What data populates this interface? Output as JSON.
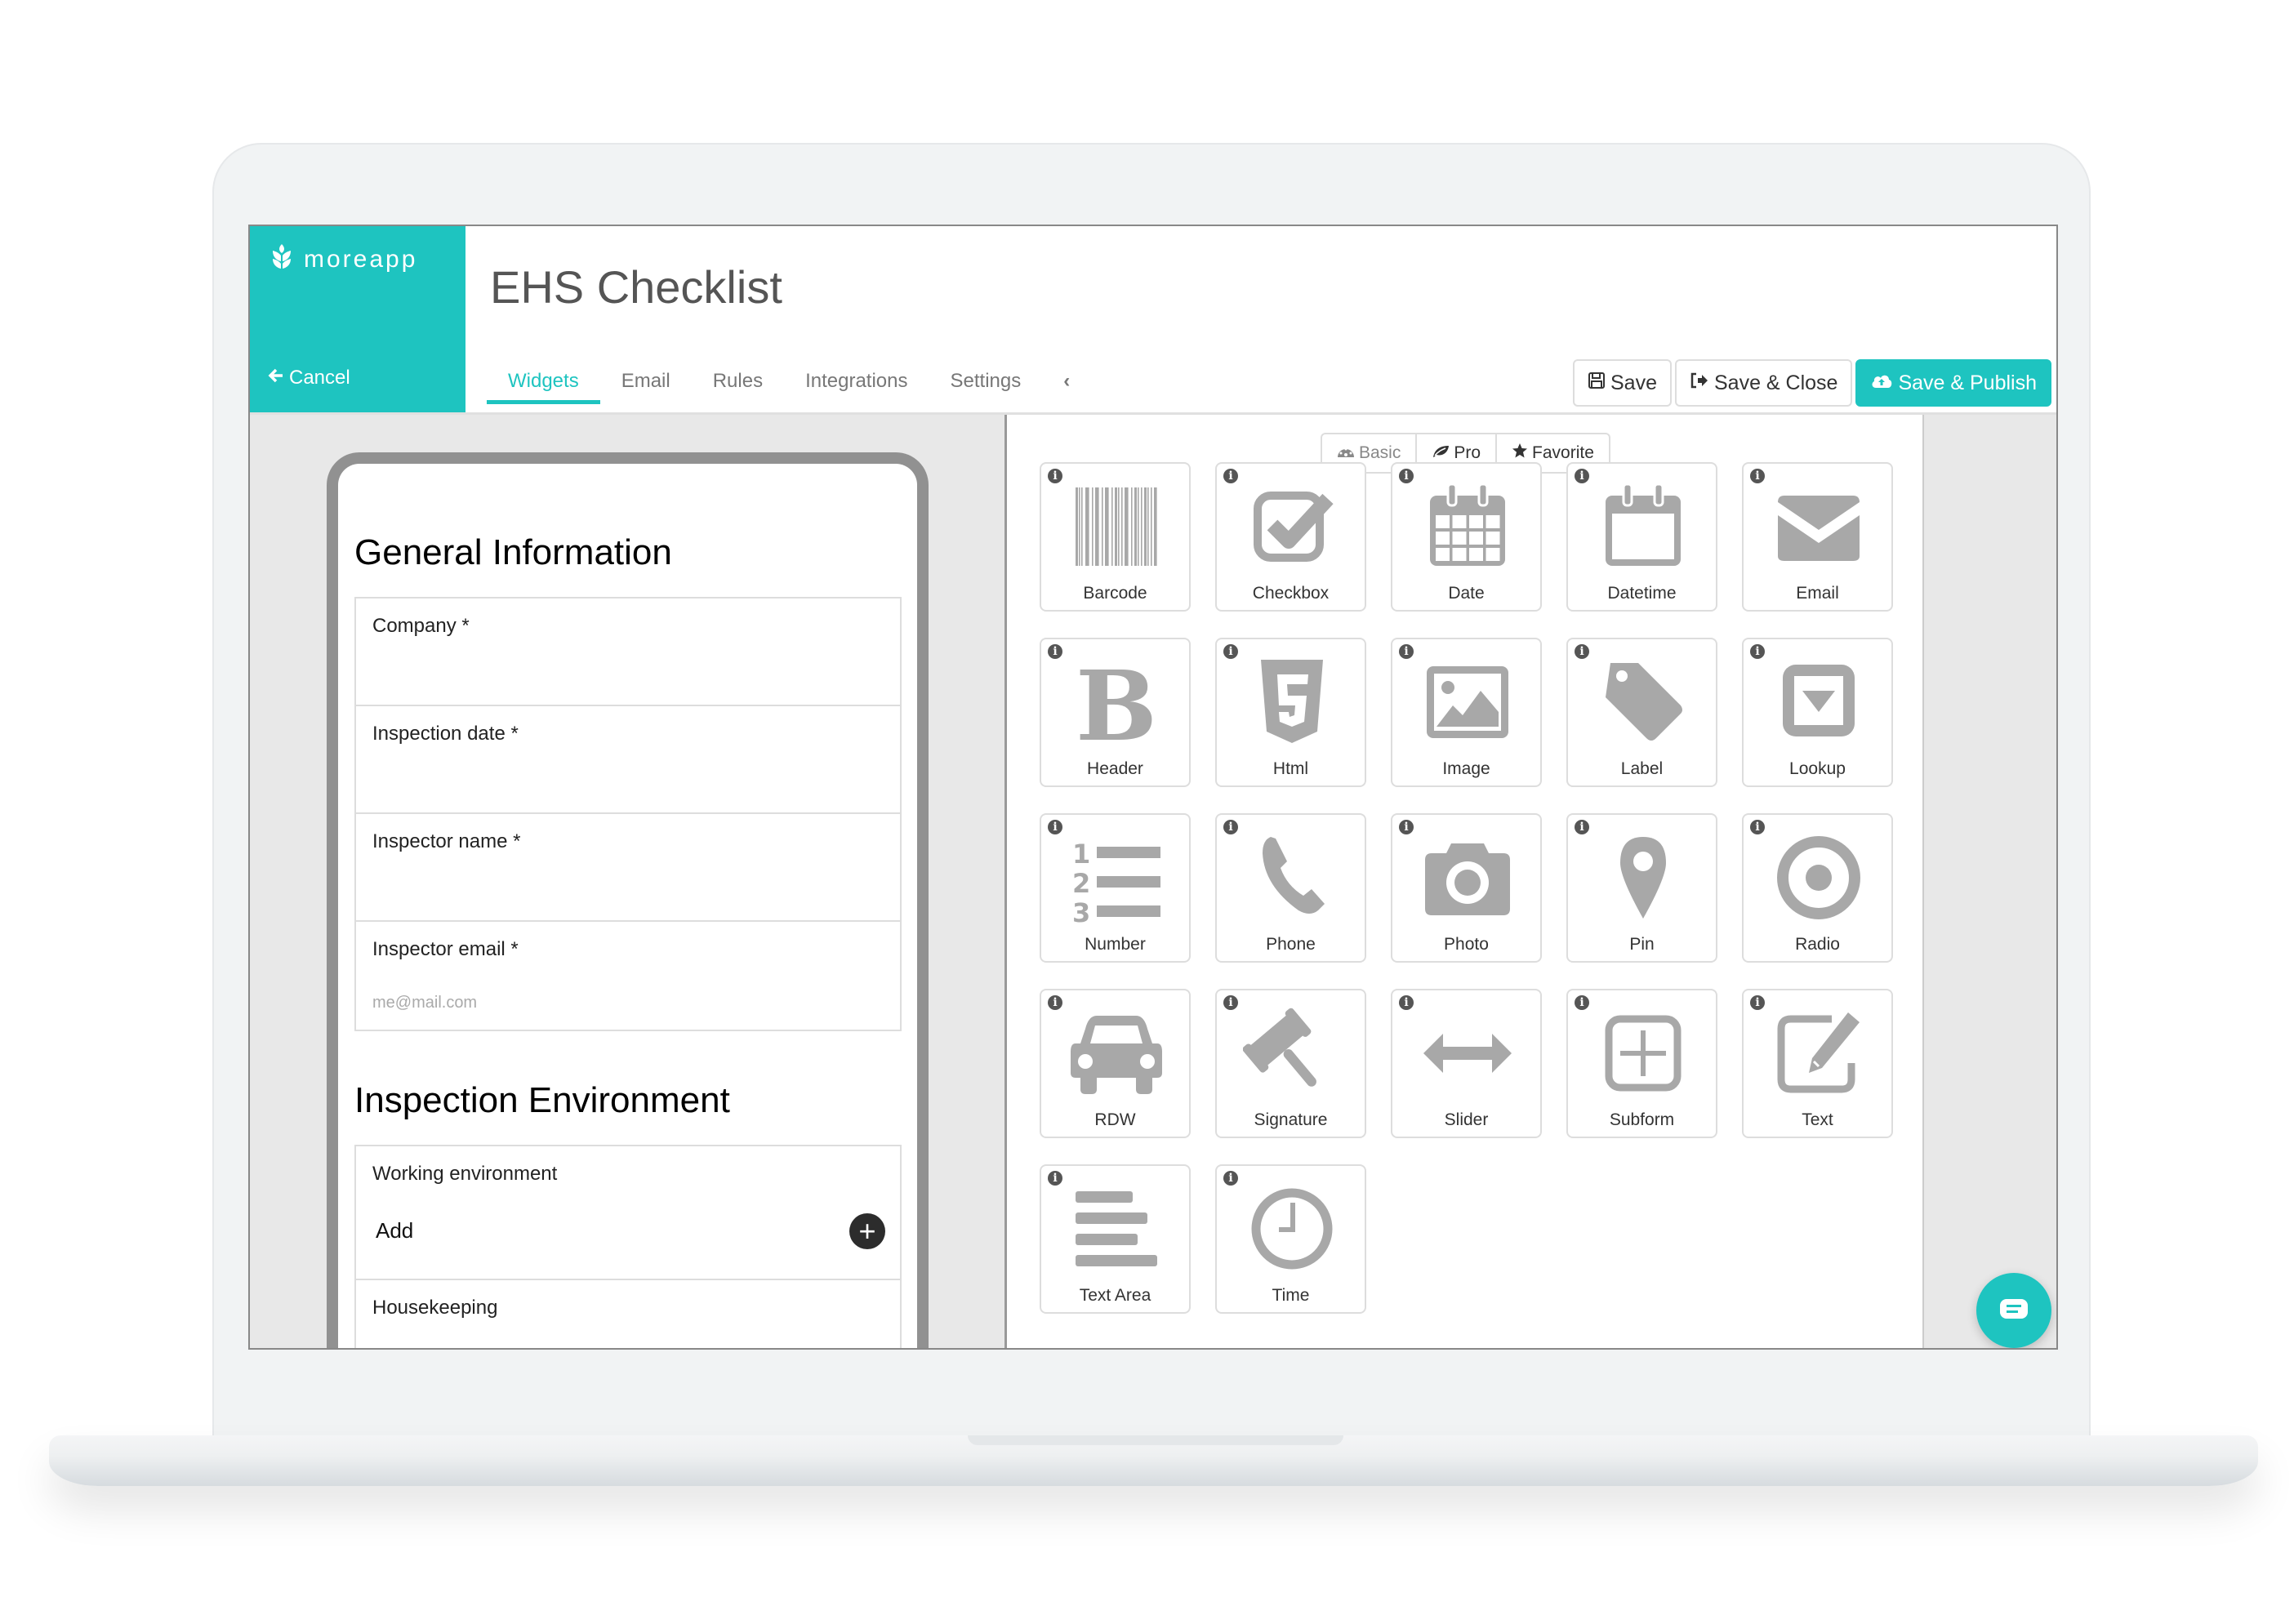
{
  "app": {
    "brand": "moreapp",
    "cancel_label": "Cancel",
    "title": "EHS Checklist",
    "accent_color": "#1ec4c0"
  },
  "tabs": [
    {
      "label": "Widgets",
      "active": true
    },
    {
      "label": "Email",
      "active": false
    },
    {
      "label": "Rules",
      "active": false
    },
    {
      "label": "Integrations",
      "active": false
    },
    {
      "label": "Settings",
      "active": false
    },
    {
      "label": "‹",
      "icon": "chevron-left-icon"
    }
  ],
  "toolbar": {
    "save_label": "Save",
    "save_close_label": "Save & Close",
    "save_publish_label": "Save & Publish"
  },
  "filters": [
    {
      "label": "Basic",
      "icon": "dashboard-icon"
    },
    {
      "label": "Pro",
      "icon": "leaf-icon"
    },
    {
      "label": "Favorite",
      "icon": "star-icon"
    }
  ],
  "form": {
    "sections": [
      {
        "title": "General Information",
        "fields": [
          {
            "label": "Company *",
            "placeholder": ""
          },
          {
            "label": "Inspection date *",
            "placeholder": ""
          },
          {
            "label": "Inspector name *",
            "placeholder": ""
          },
          {
            "label": "Inspector email *",
            "placeholder": "me@mail.com"
          }
        ]
      },
      {
        "title": "Inspection Environment",
        "fields": [
          {
            "label": "Working environment",
            "add_label": "Add"
          },
          {
            "label": "Housekeeping",
            "add_label": ""
          }
        ]
      }
    ]
  },
  "widgets": [
    {
      "label": "Barcode",
      "icon": "barcode-icon"
    },
    {
      "label": "Checkbox",
      "icon": "checkbox-icon"
    },
    {
      "label": "Date",
      "icon": "calendar-icon"
    },
    {
      "label": "Datetime",
      "icon": "calendar-empty-icon"
    },
    {
      "label": "Email",
      "icon": "envelope-icon"
    },
    {
      "label": "Header",
      "icon": "bold-b-icon"
    },
    {
      "label": "Html",
      "icon": "html5-icon"
    },
    {
      "label": "Image",
      "icon": "image-icon"
    },
    {
      "label": "Label",
      "icon": "tag-icon"
    },
    {
      "label": "Lookup",
      "icon": "dropdown-box-icon"
    },
    {
      "label": "Number",
      "icon": "numbered-list-icon"
    },
    {
      "label": "Phone",
      "icon": "phone-icon"
    },
    {
      "label": "Photo",
      "icon": "camera-icon"
    },
    {
      "label": "Pin",
      "icon": "map-pin-icon"
    },
    {
      "label": "Radio",
      "icon": "radio-icon"
    },
    {
      "label": "RDW",
      "icon": "car-icon"
    },
    {
      "label": "Signature",
      "icon": "gavel-icon"
    },
    {
      "label": "Slider",
      "icon": "arrows-horizontal-icon"
    },
    {
      "label": "Subform",
      "icon": "plus-square-icon"
    },
    {
      "label": "Text",
      "icon": "edit-icon"
    },
    {
      "label": "Text Area",
      "icon": "align-left-icon"
    },
    {
      "label": "Time",
      "icon": "clock-icon"
    }
  ]
}
